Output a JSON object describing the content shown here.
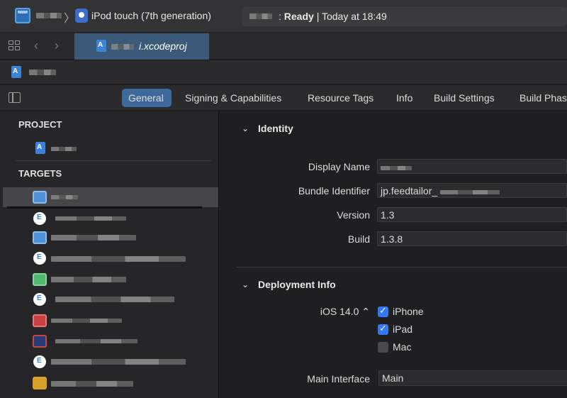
{
  "window": {
    "device": "iPod touch (7th generation)",
    "status_ready": "Ready",
    "status_time": "Today at 18:49"
  },
  "tab": {
    "file_label": "i.xcodeproj"
  },
  "editor_tabs": [
    "General",
    "Signing & Capabilities",
    "Resource Tags",
    "Info",
    "Build Settings",
    "Build Phas"
  ],
  "sidebar": {
    "project_heading": "PROJECT",
    "targets_heading": "TARGETS",
    "targets": [
      {
        "icon": "app-target-icon",
        "selected": true
      },
      {
        "icon": "extension-icon"
      },
      {
        "icon": "app-target-icon"
      },
      {
        "icon": "extension-icon"
      },
      {
        "icon": "green-app-icon"
      },
      {
        "icon": "extension-icon"
      },
      {
        "icon": "red-app-icon"
      },
      {
        "icon": "darkred-app-icon"
      },
      {
        "icon": "extension-icon"
      },
      {
        "icon": "framework-kit-icon"
      }
    ]
  },
  "identity": {
    "title": "Identity",
    "display_name_label": "Display Name",
    "bundle_id_label": "Bundle Identifier",
    "bundle_id_value": "jp.feedtailor_",
    "version_label": "Version",
    "version_value": "1.3",
    "build_label": "Build",
    "build_value": "1.3.8"
  },
  "deployment": {
    "title": "Deployment Info",
    "ios_target": "iOS 14.0 ⌃",
    "devices": [
      {
        "label": "iPhone",
        "checked": true
      },
      {
        "label": "iPad",
        "checked": true
      },
      {
        "label": "Mac",
        "checked": false
      }
    ],
    "main_interface_label": "Main Interface",
    "main_interface_value": "Main"
  }
}
